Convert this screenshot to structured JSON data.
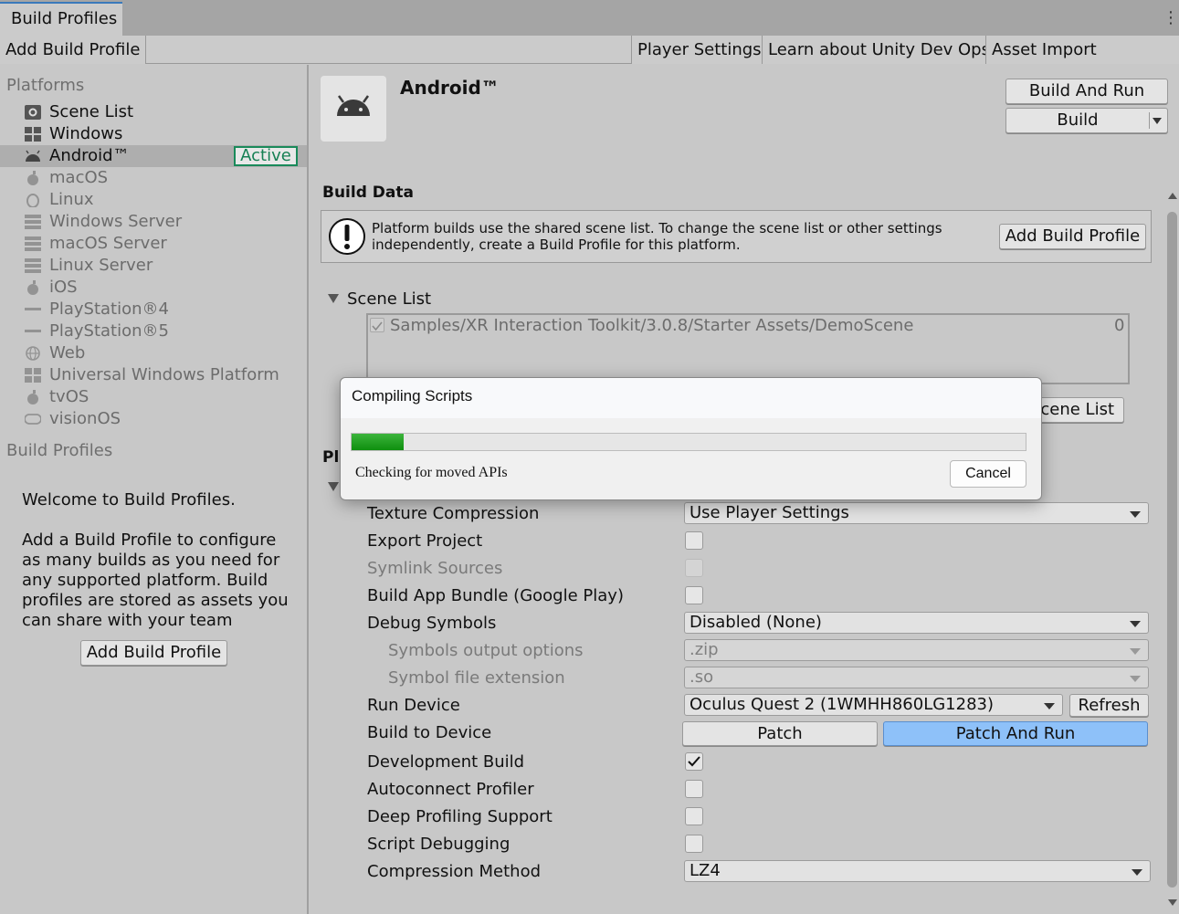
{
  "window": {
    "tab_title": "Build Profiles",
    "menu_icon": "kebab-menu-icon"
  },
  "toolbar": {
    "add_build_profile": "Add Build Profile",
    "player_settings": "Player Settings",
    "learn_dev_ops": "Learn about Unity Dev Ops",
    "asset_import_overrides": "Asset Import Overrides"
  },
  "sidebar": {
    "platforms_header": "Platforms",
    "items": [
      {
        "label": "Scene List",
        "icon": "gear-icon"
      },
      {
        "label": "Windows",
        "icon": "windows-icon"
      },
      {
        "label": "Android™",
        "icon": "android-icon",
        "badge": "Active"
      },
      {
        "label": "macOS",
        "icon": "apple-icon"
      },
      {
        "label": "Linux",
        "icon": "linux-icon"
      },
      {
        "label": "Windows Server",
        "icon": "server-icon"
      },
      {
        "label": "macOS Server",
        "icon": "server-icon"
      },
      {
        "label": "Linux Server",
        "icon": "server-icon"
      },
      {
        "label": "iOS",
        "icon": "apple-icon"
      },
      {
        "label": "PlayStation®4",
        "icon": "ps-icon"
      },
      {
        "label": "PlayStation®5",
        "icon": "ps-icon"
      },
      {
        "label": "Web",
        "icon": "globe-icon"
      },
      {
        "label": "Universal Windows Platform",
        "icon": "windows-icon"
      },
      {
        "label": "tvOS",
        "icon": "apple-icon"
      },
      {
        "label": "visionOS",
        "icon": "vision-icon"
      }
    ],
    "profiles_header": "Build Profiles",
    "welcome_title": "Welcome to Build Profiles.",
    "welcome_body": "Add a Build Profile to configure as many builds as you need for any supported platform. Build profiles are stored as assets you can share with your team",
    "add_button": "Add Build Profile"
  },
  "main": {
    "platform_title": "Android™",
    "build_and_run": "Build And Run",
    "build": "Build",
    "build_data_header": "Build Data",
    "info_text": "Platform builds use the shared scene list. To change the scene list or other settings independently, create a Build Profile for this platform.",
    "info_add_button": "Add Build Profile",
    "scene_list_header": "Scene List",
    "scene_path": "Samples/XR Interaction Toolkit/3.0.8/Starter Assets/DemoScene",
    "scene_index": "0",
    "scene_list_button_partial": "cene List",
    "platform_settings_partial": "Pla",
    "settings": {
      "texture_compression": {
        "label": "Texture Compression",
        "value": "Use Player Settings"
      },
      "export_project": {
        "label": "Export Project",
        "checked": false
      },
      "symlink_sources": {
        "label": "Symlink Sources",
        "checked": false
      },
      "build_app_bundle": {
        "label": "Build App Bundle (Google Play)",
        "checked": false
      },
      "debug_symbols": {
        "label": "Debug Symbols",
        "value": "Disabled (None)"
      },
      "symbols_output": {
        "label": "Symbols output options",
        "value": ".zip"
      },
      "symbol_extension": {
        "label": "Symbol file extension",
        "value": ".so"
      },
      "run_device": {
        "label": "Run Device",
        "value": "Oculus Quest 2 (1WMHH860LG1283)",
        "refresh": "Refresh"
      },
      "build_to_device": {
        "label": "Build to Device",
        "patch": "Patch",
        "patch_and_run": "Patch And Run"
      },
      "development_build": {
        "label": "Development Build",
        "checked": true
      },
      "autoconnect_profiler": {
        "label": "Autoconnect Profiler",
        "checked": false
      },
      "deep_profiling": {
        "label": "Deep Profiling Support",
        "checked": false
      },
      "script_debugging": {
        "label": "Script Debugging",
        "checked": false
      },
      "compression_method": {
        "label": "Compression Method",
        "value": "LZ4"
      }
    }
  },
  "dialog": {
    "title": "Compiling Scripts",
    "message": "Checking for moved APIs",
    "cancel": "Cancel",
    "progress": 0.077,
    "progress_color": "#12901a"
  }
}
